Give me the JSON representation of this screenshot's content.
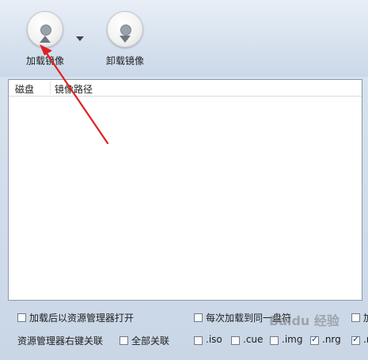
{
  "toolbar": {
    "mount_label": "加载镜像",
    "unmount_label": "卸载镜像",
    "dropdown_icon": "triangle-down"
  },
  "list": {
    "columns": [
      "磁盘",
      "镜像路径"
    ],
    "rows": []
  },
  "options": {
    "open_explorer_after_mount": {
      "label": "加载后以资源管理器打开",
      "checked": false
    },
    "mount_to_same_drive": {
      "label": "每次加载到同一盘符",
      "checked": false
    },
    "right_edge_option": {
      "label": "加",
      "checked": false
    },
    "context_menu_label": "资源管理器右键关联",
    "all_assoc": {
      "label": "全部关联",
      "checked": false
    },
    "extensions": [
      {
        "label": ".iso",
        "checked": false
      },
      {
        "label": ".cue",
        "checked": false
      },
      {
        "label": ".img",
        "checked": false
      },
      {
        "label": ".nrg",
        "checked": true
      },
      {
        "label": ".r",
        "checked": true
      }
    ]
  },
  "watermark": "Baidu 经验",
  "colors": {
    "annotation_arrow": "#e02020",
    "accent": "#1c3f8a"
  }
}
